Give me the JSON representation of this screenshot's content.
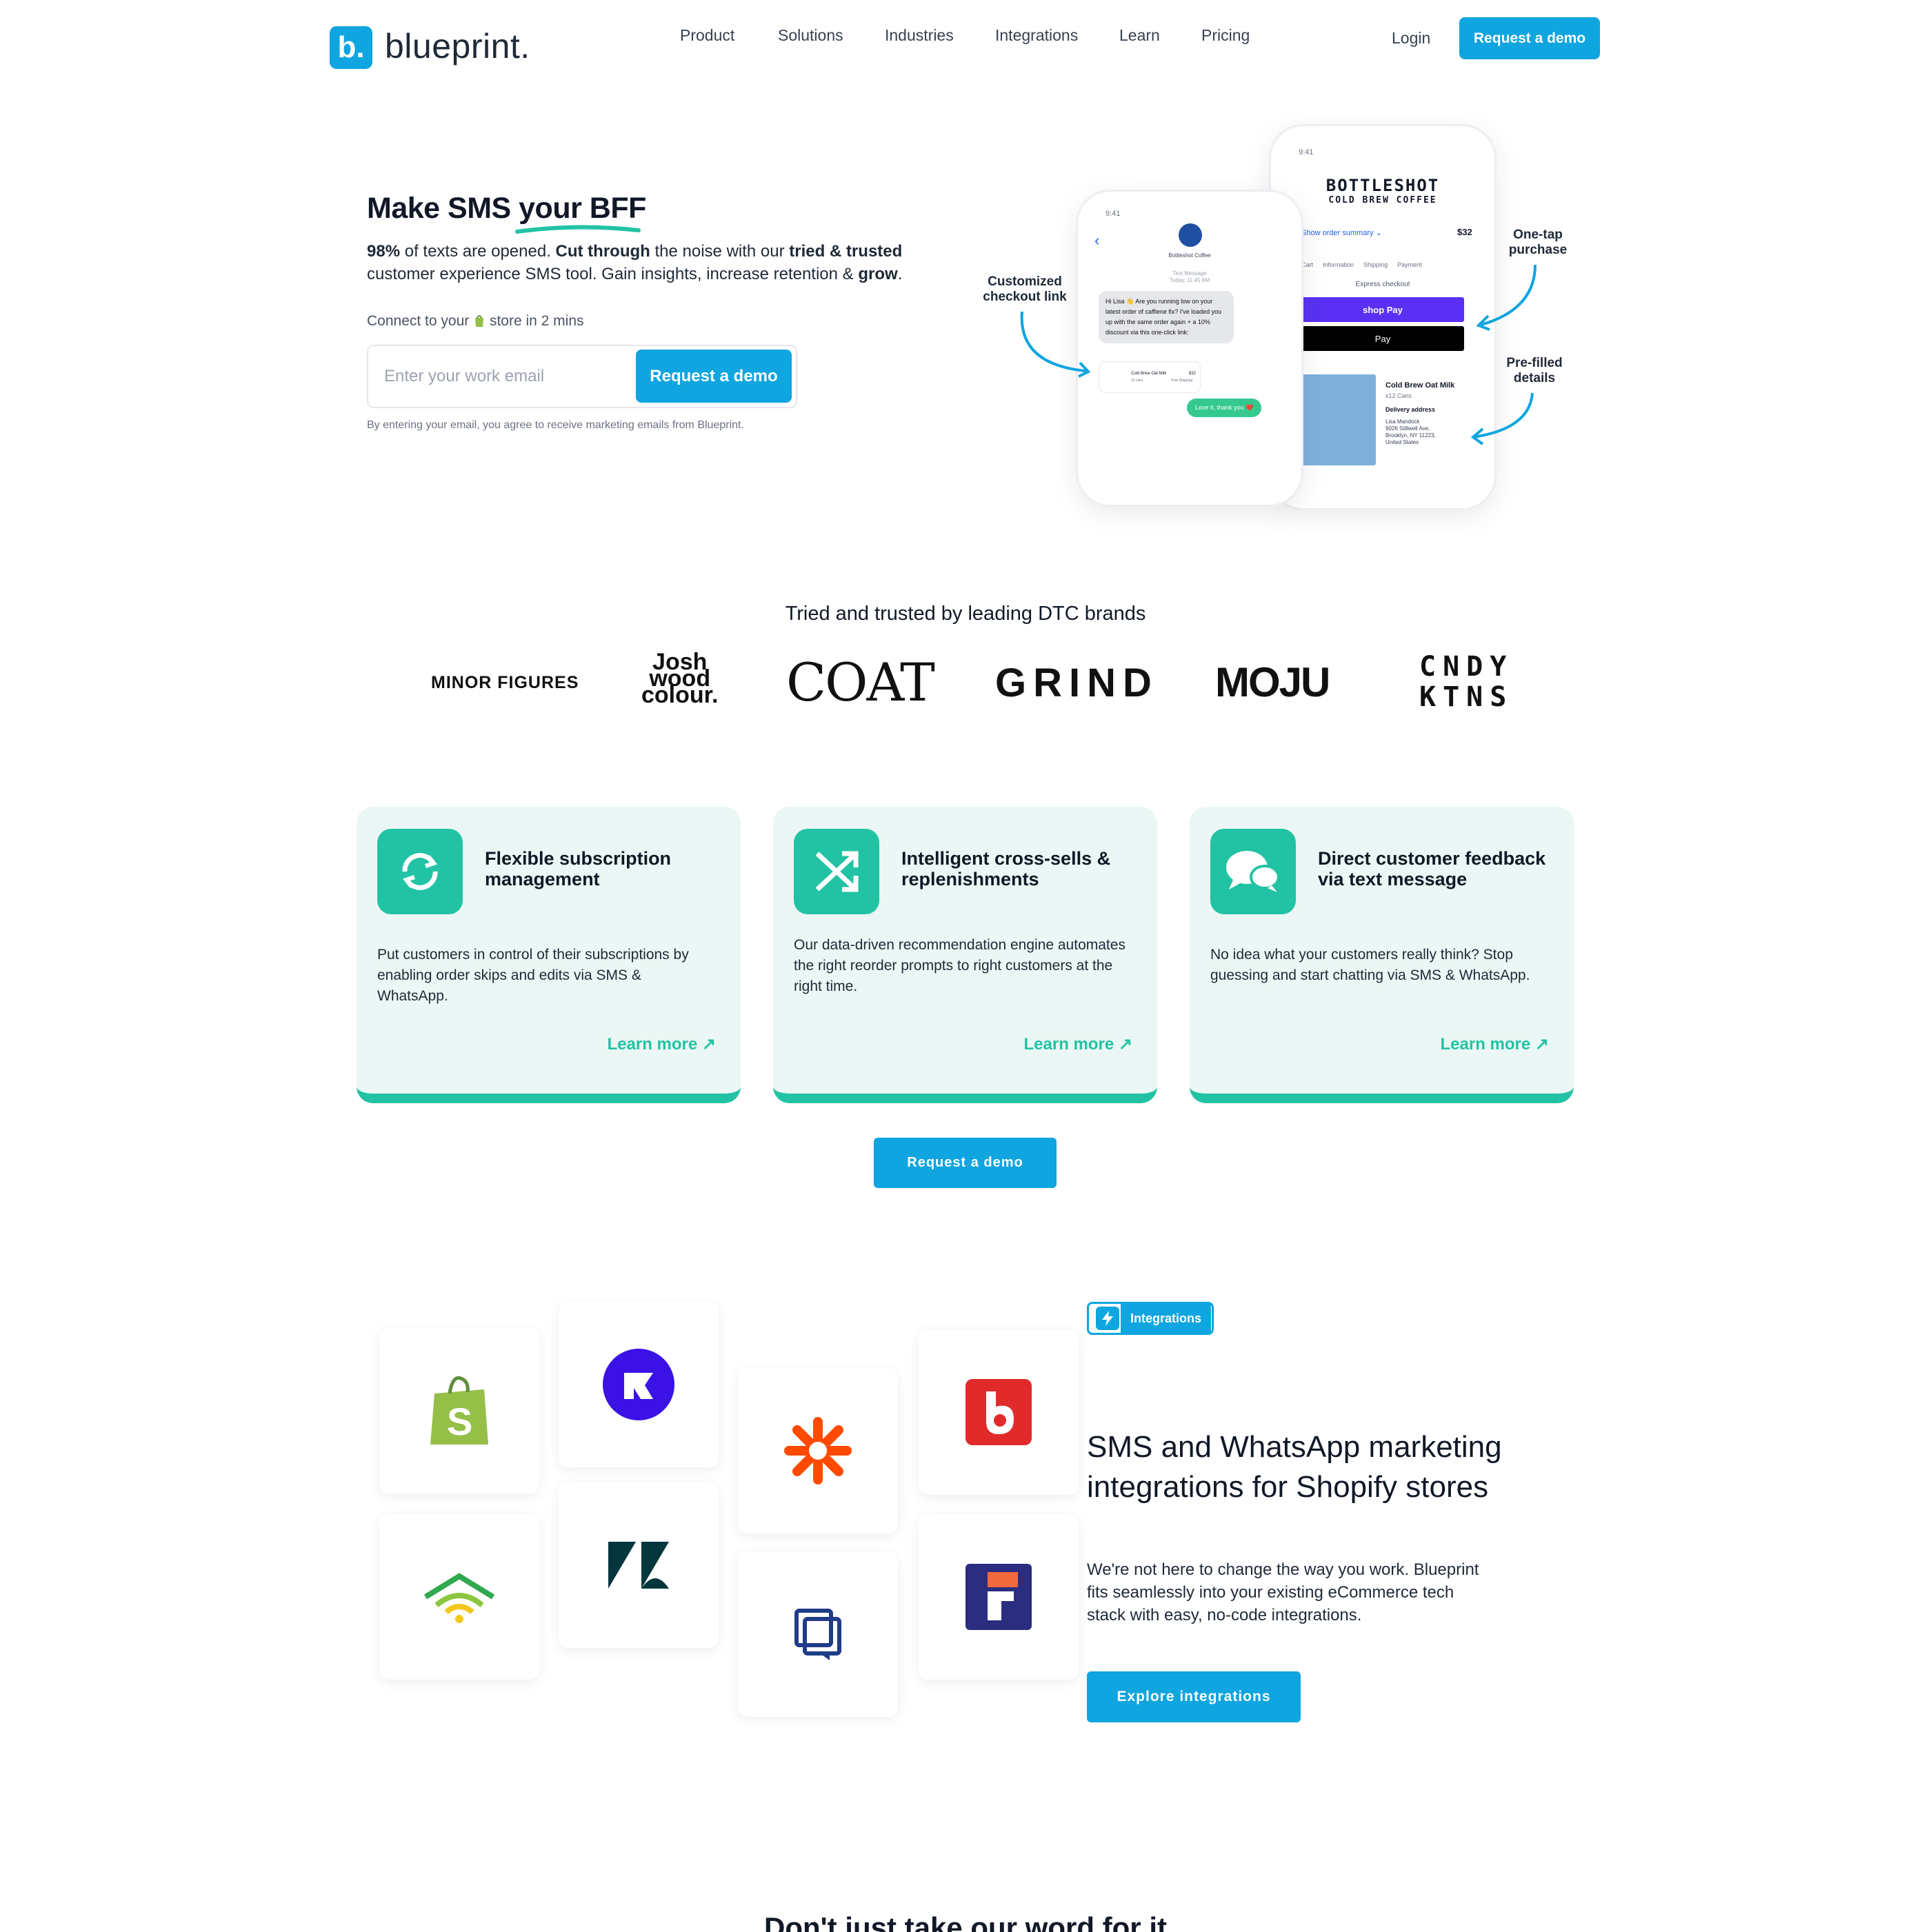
{
  "brand": {
    "logo_letter": "b.",
    "name": "blueprint."
  },
  "nav": {
    "items": [
      "Product",
      "Solutions",
      "Industries",
      "Integrations",
      "Learn",
      "Pricing"
    ],
    "login": "Login",
    "cta": "Request a demo"
  },
  "hero": {
    "title": "Make SMS your BFF",
    "para_stat": "98%",
    "para_1": " of texts are opened. ",
    "para_bold_1": "Cut through",
    "para_2": " the noise with our ",
    "para_bold_2": "tried & trusted",
    "para_3": " customer experience SMS tool. Gain insights, increase retention & ",
    "para_bold_3": "grow",
    "para_4": ".",
    "connect_prefix": "Connect to your",
    "connect_suffix": "store in 2 mins",
    "email_placeholder": "Enter your work email",
    "cta": "Request a demo",
    "disclaimer": "By entering your email, you agree to receive marketing emails from Blueprint."
  },
  "phones": {
    "time": "9:41",
    "sender": "Bottleshot Coffee",
    "msg_meta": "Text Message",
    "msg_time": "Today, 11:45 AM",
    "msg": "Hi Lisa 👋 Are you running low on your latest order of caffiene fix? I've loaded you up with the same order again + a 10% discount via this one-click link:",
    "link_product": "Cold Brew Oat Milk",
    "link_price": "$32",
    "link_sub": "12 cans",
    "link_ship": "Free Shipping",
    "reply": "Love it, thank you ❤️",
    "store_name": "BOTTLESHOT",
    "store_sub": "COLD BREW COFFEE",
    "order_summary": "Show order summary ⌄",
    "order_total": "$32",
    "crumbs": [
      "Cart",
      "Information",
      "Shipping",
      "Payment"
    ],
    "express": "Express checkout",
    "shop_pay": "shop Pay",
    "apple_pay": "Pay",
    "product": "Cold Brew Oat Milk",
    "product_sub": "x12 Cans",
    "delivery_label": "Delivery address",
    "delivery_name": "Lisa Mandock",
    "delivery_addr1": "9026 Stillwell Ave,",
    "delivery_addr2": "Brooklyn, NY 11223,",
    "delivery_addr3": "United States"
  },
  "callouts": {
    "checkout_1": "Customized",
    "checkout_2": "checkout link",
    "onetap_1": "One-tap",
    "onetap_2": "purchase",
    "prefilled_1": "Pre-filled",
    "prefilled_2": "details"
  },
  "trusted": {
    "heading": "Tried and trusted by leading DTC brands",
    "brands": [
      "MINOR FIGURES",
      "josh wood colour.",
      "COAT",
      "GRIND",
      "MOJU",
      "CNDY KTNS"
    ],
    "josh_1": "Josh",
    "josh_2": "wood",
    "josh_3": "colour.",
    "cndy_1": "CNDY",
    "cndy_2": "KTNS"
  },
  "features": [
    {
      "title": "Flexible subscription management",
      "text": "Put customers in control of their subscriptions by enabling order skips and edits via SMS & WhatsApp.",
      "link": "Learn more ↗"
    },
    {
      "title": "Intelligent cross-sells & replenishments",
      "text": "Our data-driven recommendation engine automates the right reorder prompts to right customers at the right time.",
      "link": "Learn more ↗"
    },
    {
      "title": "Direct customer feedback via text message",
      "text": "No idea what your customers really think? Stop guessing and start chatting via SMS & WhatsApp.",
      "link": "Learn more ↗"
    }
  ],
  "mid_cta": "Request a demo",
  "integrations": {
    "badge": "Integrations",
    "title": "SMS and WhatsApp marketing integrations for Shopify stores",
    "para": "We're not here to change the way you work. Blueprint fits seamlessly into your existing eCommerce tech stack with easy, no-code integrations.",
    "cta": "Explore integrations",
    "tiles": [
      "shopify-icon",
      "recharge-icon",
      "zapier-icon",
      "bold-icon",
      "wifi-icon",
      "zendesk-icon",
      "gorgias-icon",
      "rebuy-icon"
    ]
  },
  "testimonial_heading": "Don't just take our word for it",
  "colors": {
    "primary": "#0ea5e0",
    "teal": "#22c3a4",
    "card_bg": "#eaf7f4"
  }
}
